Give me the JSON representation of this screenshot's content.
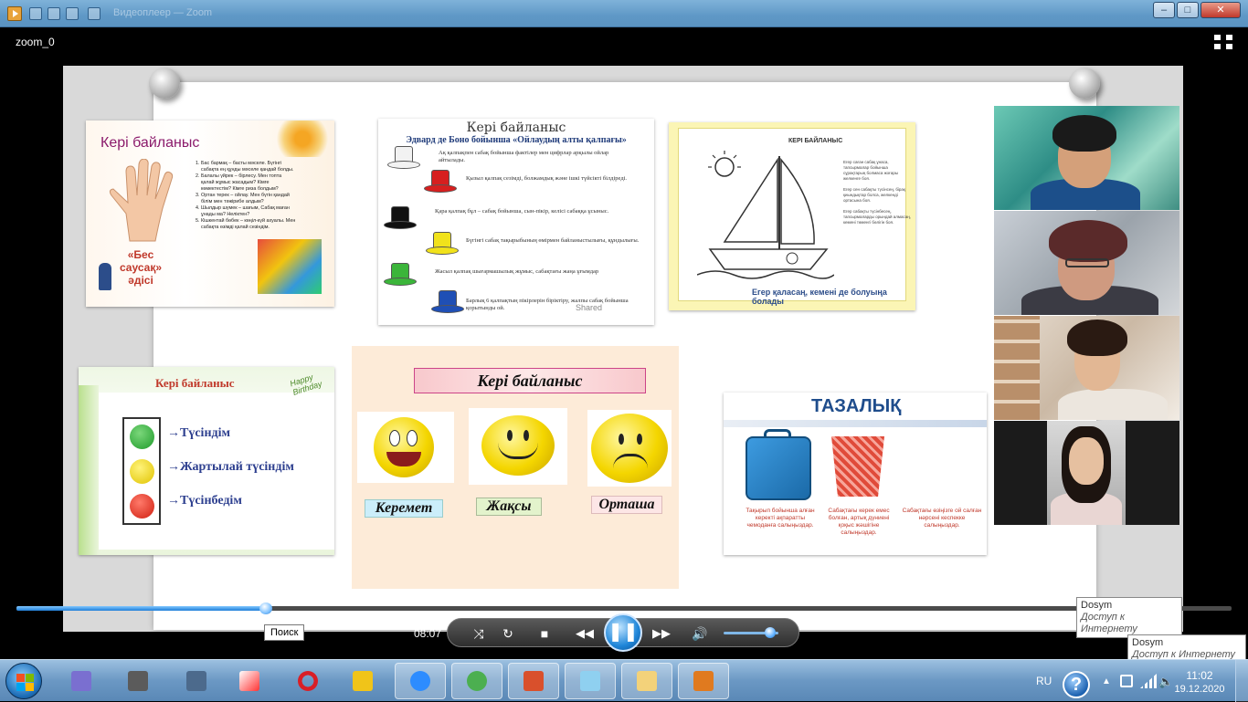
{
  "window": {
    "title": "Видеоплеер — Zoom",
    "controls": [
      "–",
      "□",
      "✕"
    ]
  },
  "player": {
    "file_label": "zoom_0",
    "tooltip": "Поиск",
    "time": "08:07",
    "progress": 0.205,
    "volume": 0.85
  },
  "slides": {
    "s1": {
      "title": "Кері байланыс",
      "method": "«Бес саусақ» әдісі",
      "items": [
        "Бас бармақ – басты мәселе. Бүгінгі сабақта ең құнды мәселе қандай болды.",
        "Балалы үйрек – бірлесу. Мен топта қалай жұмыс жасадым? Кімге көмектестім? Кімге риза болдым?",
        "Ортан терек – ойлау. Мен бүгін қандай білім мен тәжірибе алдым?",
        "Шылдыр шүмек – шағым, Сабақ маған ұнады ма? Неліктен?",
        "Кішкентай бөбек – көңіл-күй ахуалы. Мен сабақта өзімді қалай сезіндім."
      ]
    },
    "s2": {
      "title": "Кері байланыс",
      "subtitle": "Эдвард де Боно бойынша «Ойлаудың алты қалпағы»",
      "hats": [
        {
          "color": "#f2f2f2",
          "text": "Ақ қалпақпен сабақ бойынша фактілер мен цифрлар арқылы ойлар айтылады."
        },
        {
          "color": "#d61f1f",
          "text": "Қызыл қалпақ сезімді, болжамдық және ішкі түйсікті білдіреді."
        },
        {
          "color": "#111111",
          "text": "Қара қалпақ бұл – сабақ бойынша, сын-пікір, келісі сабаққа ұсыныс."
        },
        {
          "color": "#f1e21b",
          "text": "Бүгінгі сабақ тақырыбының өмірмен байланыстылығы, құндылығы."
        },
        {
          "color": "#3bb53a",
          "text": "Жасыл қалпақ шығармашылық жұмыс, сабақтағы жаңа ұғымдар"
        },
        {
          "color": "#1f4fb5",
          "text": "Барлық 6 қалпақтың пікірлерін біріктіру, жалпы сабақ бойынша қорытынды ой."
        }
      ],
      "watermark": "Shared"
    },
    "s3": {
      "title": "КЕРІ БАЙЛАНЫС",
      "caption": "Егер қаласаң, кемені де болуыңа болады",
      "text": [
        "Егер саған сабақ ұнаса, тапсырмалар бойынша сұрақтарың болмаса жоғары желкенге боя.",
        "Егер сен сабақты түсінсең, бірақ қиындықтар болса, желкенді ортасына боя.",
        "Егер сабақты түсінбесең, тапсырмаларды орындай алмасаң, кемені төменгі бөлігін боя."
      ]
    },
    "s4": {
      "title": "Кері байланыс",
      "happy": "Happy Birthday",
      "levels": [
        "→Түсіндім",
        "→Жартылай түсіндім",
        "→Түсінбедім"
      ]
    },
    "s5": {
      "title": "Кері  байланыс",
      "labels": [
        "Керемет",
        "Жақсы",
        "Орташа"
      ]
    },
    "s6": {
      "title": "ТАЗАЛЫҚ",
      "captions": [
        "Тақырып бойынша алған керекті ақпаратты чемоданға салыңыздар.",
        "Сабақтағы керек емес болған, артық дүниені қоқыс жәшігіне салыңыздар.",
        "Сабақтағы өзіңізге ой салған нәрсені кеспекке салыңыздар."
      ]
    }
  },
  "notifications": [
    {
      "name": "Dosym",
      "status": "Доступ к Интернету"
    },
    {
      "name": "Dosym",
      "status": "Доступ к Интернету"
    }
  ],
  "taskbar": {
    "apps": [
      "media-library",
      "world-of-tanks",
      "world-of-warships",
      "yandex",
      "opera",
      "game-shield",
      "zoom",
      "chrome",
      "powerpoint",
      "paint",
      "explorer",
      "media-player"
    ],
    "language": "RU",
    "time": "11:02",
    "date": "19.12.2020"
  }
}
